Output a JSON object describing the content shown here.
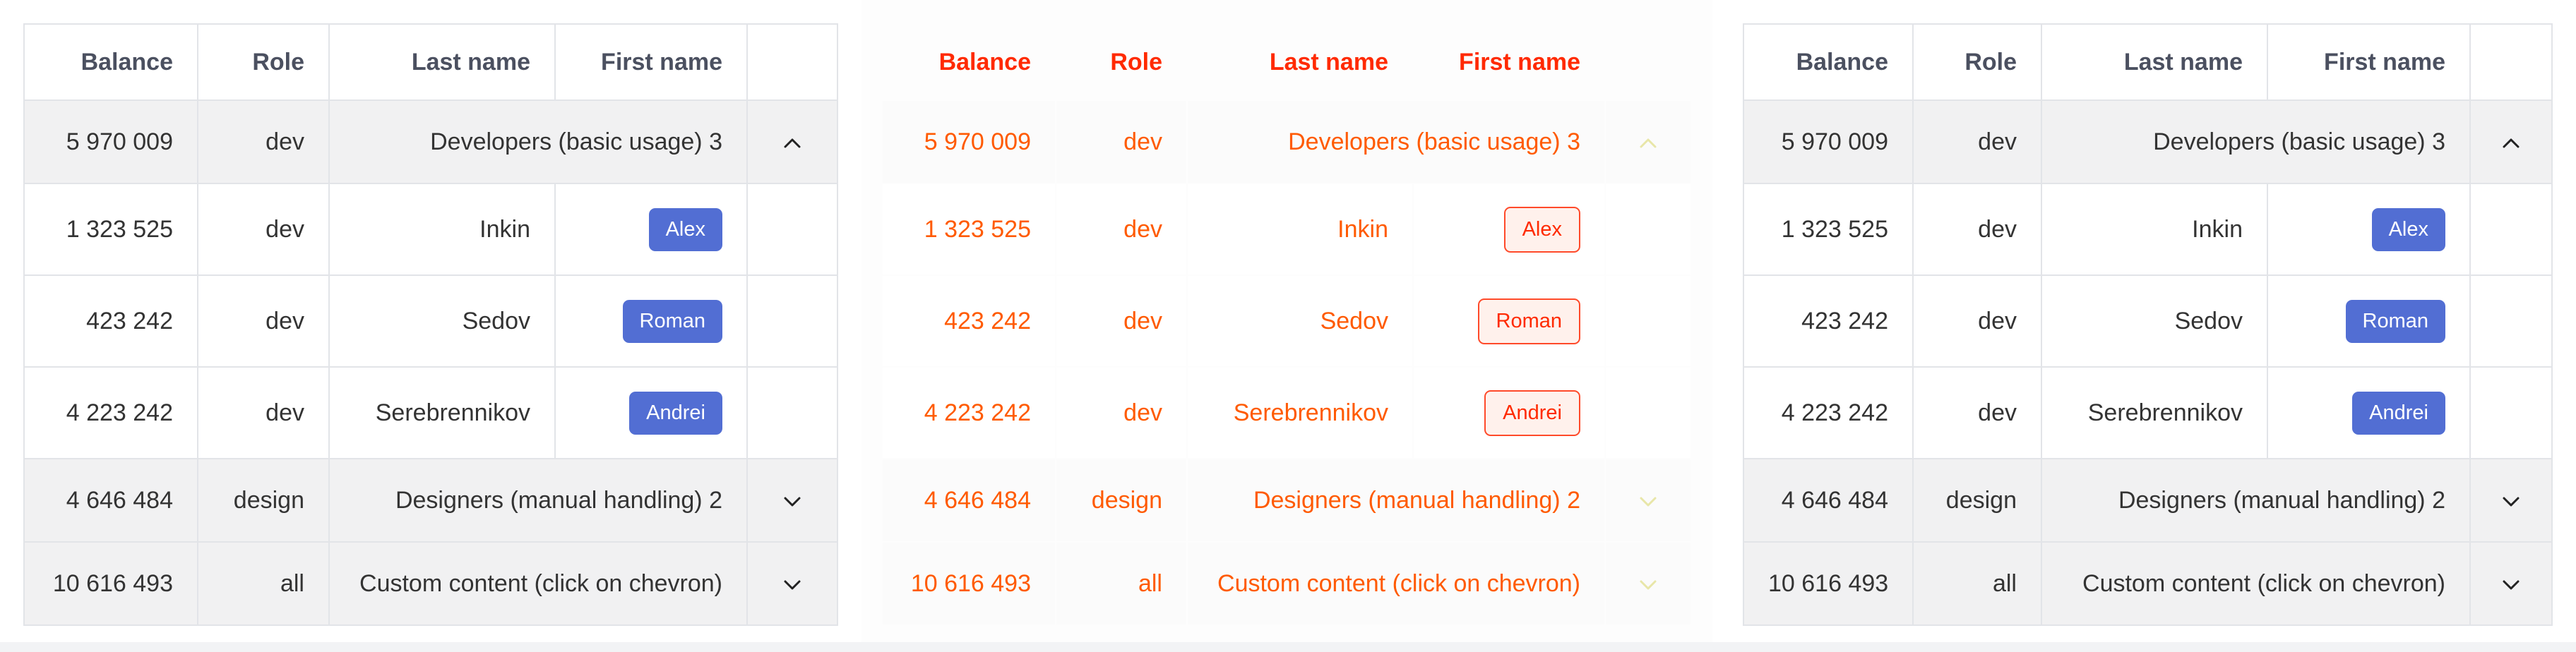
{
  "colors": {
    "accent": "#526ed3",
    "header_text": "#4b5060",
    "group_bg": "#f1f1f2",
    "border": "#e2e4e8",
    "ghost_text": "#ff5a00"
  },
  "columns": [
    "Balance",
    "Role",
    "Last name",
    "First name"
  ],
  "rows": [
    {
      "kind": "group",
      "balance": "5 970 009",
      "role": "dev",
      "label": "Developers (basic usage) 3",
      "chevron": "chevron-up-icon"
    },
    {
      "kind": "row",
      "balance": "1 323 525",
      "role": "dev",
      "last_name": "Inkin",
      "first_name": "Alex"
    },
    {
      "kind": "row",
      "balance": "423 242",
      "role": "dev",
      "last_name": "Sedov",
      "first_name": "Roman"
    },
    {
      "kind": "row",
      "balance": "4 223 242",
      "role": "dev",
      "last_name": "Serebrennikov",
      "first_name": "Andrei"
    },
    {
      "kind": "group",
      "balance": "4 646 484",
      "role": "design",
      "label": "Designers (manual handling) 2",
      "chevron": "chevron-down-icon"
    },
    {
      "kind": "group",
      "balance": "10 616 493",
      "role": "all",
      "label": "Custom content (click on chevron)",
      "chevron": "chevron-down-icon"
    }
  ]
}
